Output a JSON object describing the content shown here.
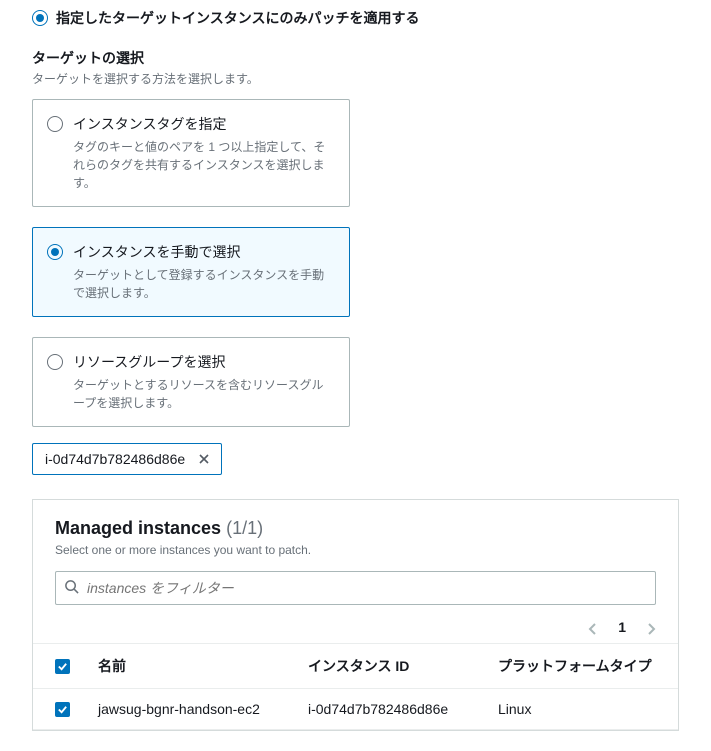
{
  "top_radio": {
    "label": "指定したターゲットインスタンスにのみパッチを適用する"
  },
  "target_select": {
    "title": "ターゲットの選択",
    "desc": "ターゲットを選択する方法を選択します。"
  },
  "cards": {
    "tag": {
      "title": "インスタンスタグを指定",
      "desc": "タグのキーと値のペアを 1 つ以上指定して、それらのタグを共有するインスタンスを選択します。"
    },
    "manual": {
      "title": "インスタンスを手動で選択",
      "desc": "ターゲットとして登録するインスタンスを手動で選択します。"
    },
    "resource": {
      "title": "リソースグループを選択",
      "desc": "ターゲットとするリソースを含むリソースグループを選択します。"
    }
  },
  "chip": {
    "text": "i-0d74d7b782486d86e"
  },
  "panel": {
    "title": "Managed instances",
    "count": "(1/1)",
    "desc": "Select one or more instances you want to patch.",
    "filter_placeholder": "instances をフィルター",
    "page": "1",
    "columns": {
      "name": "名前",
      "id": "インスタンス ID",
      "platform": "プラットフォームタイプ"
    },
    "rows": [
      {
        "name": "jawsug-bgnr-handson-ec2",
        "id": "i-0d74d7b782486d86e",
        "platform": "Linux"
      }
    ]
  }
}
